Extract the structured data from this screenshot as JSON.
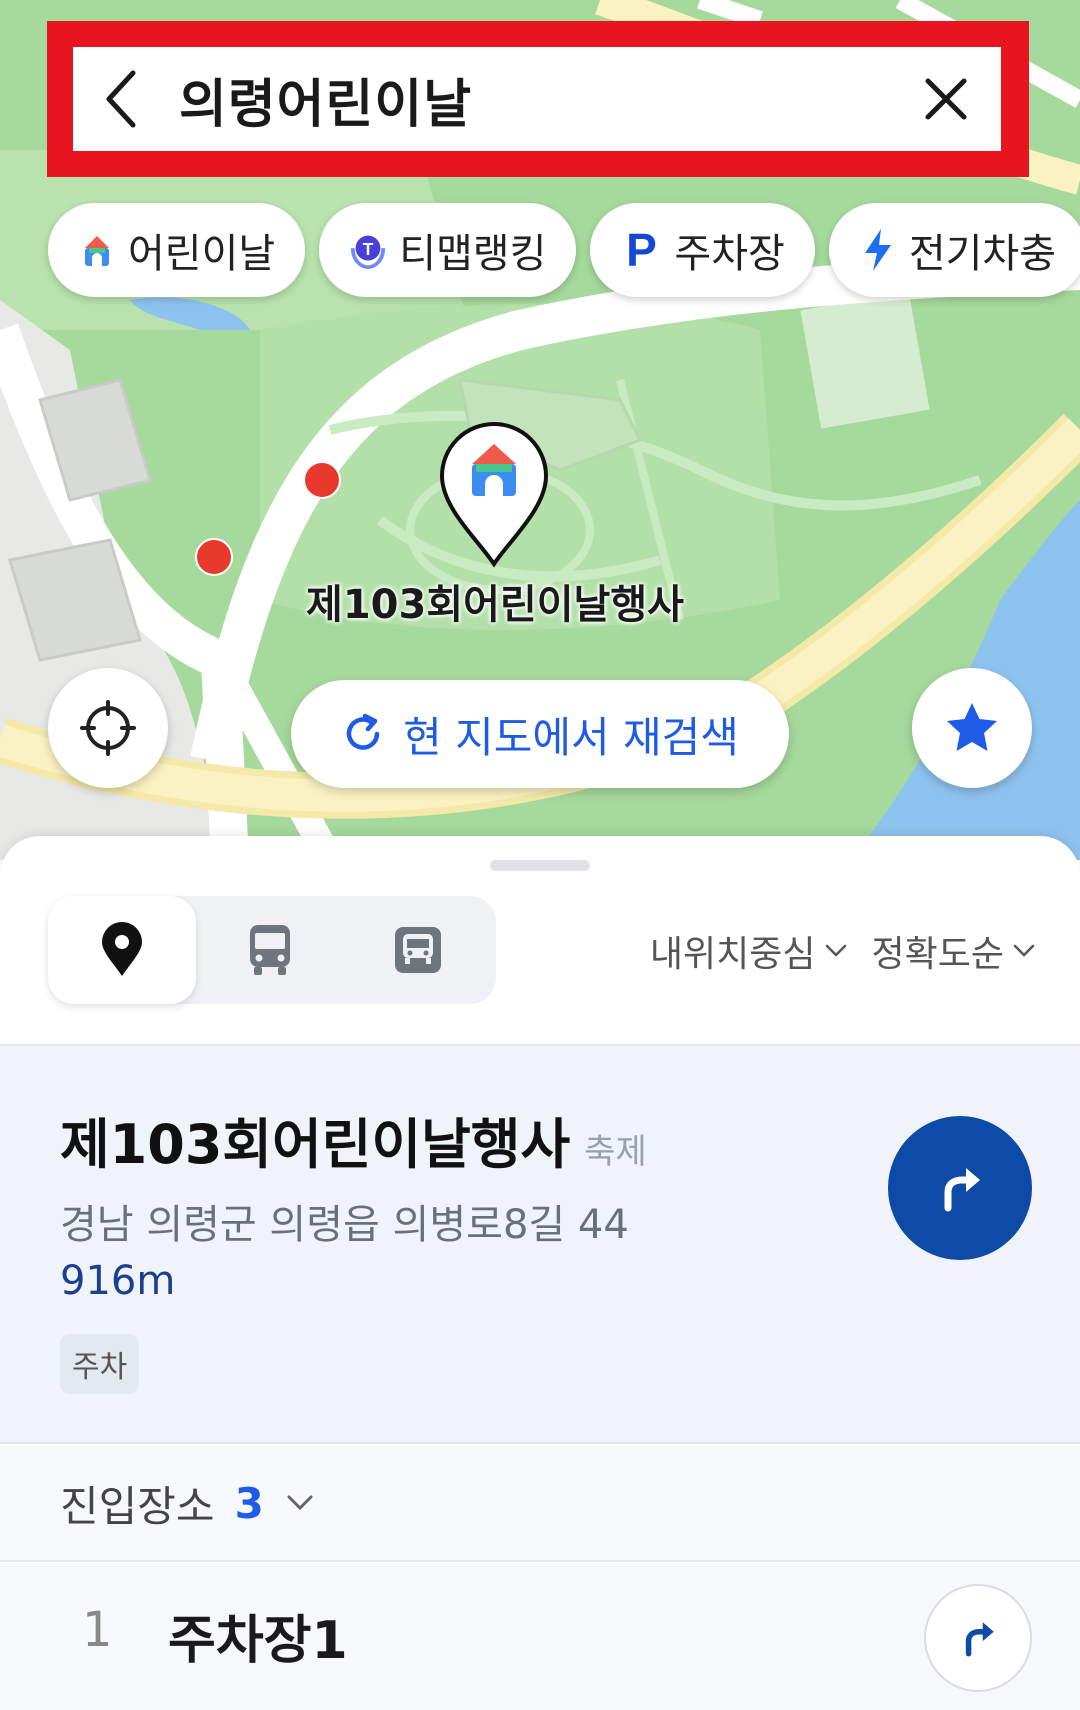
{
  "search": {
    "query": "의령어린이날"
  },
  "chips": [
    {
      "label": "어린이날",
      "icon": "festival-icon"
    },
    {
      "label": "티맵랭킹",
      "icon": "tmap-ranking-icon"
    },
    {
      "label": "주차장",
      "icon": "parking-icon",
      "icon_text": "P"
    },
    {
      "label": "전기차충",
      "icon": "lightning-icon"
    }
  ],
  "map": {
    "marker_label": "제103회어린이날행사",
    "research_label": "현 지도에서 재검색"
  },
  "sheet": {
    "sort_location": "내위치중심",
    "sort_accuracy": "정확도순"
  },
  "result": {
    "name": "제103회어린이날행사",
    "category": "축제",
    "address": "경남 의령군 의령읍 의병로8길 44",
    "distance": "916m",
    "tag": "주차"
  },
  "entrance": {
    "label": "진입장소",
    "count": "3"
  },
  "sub_items": [
    {
      "number": "1",
      "name": "주차장1"
    }
  ],
  "colors": {
    "accent_blue": "#1e5be6",
    "route_button": "#0e4aa8",
    "highlight_frame": "#e8141f",
    "map_park": "#a9dca0"
  }
}
